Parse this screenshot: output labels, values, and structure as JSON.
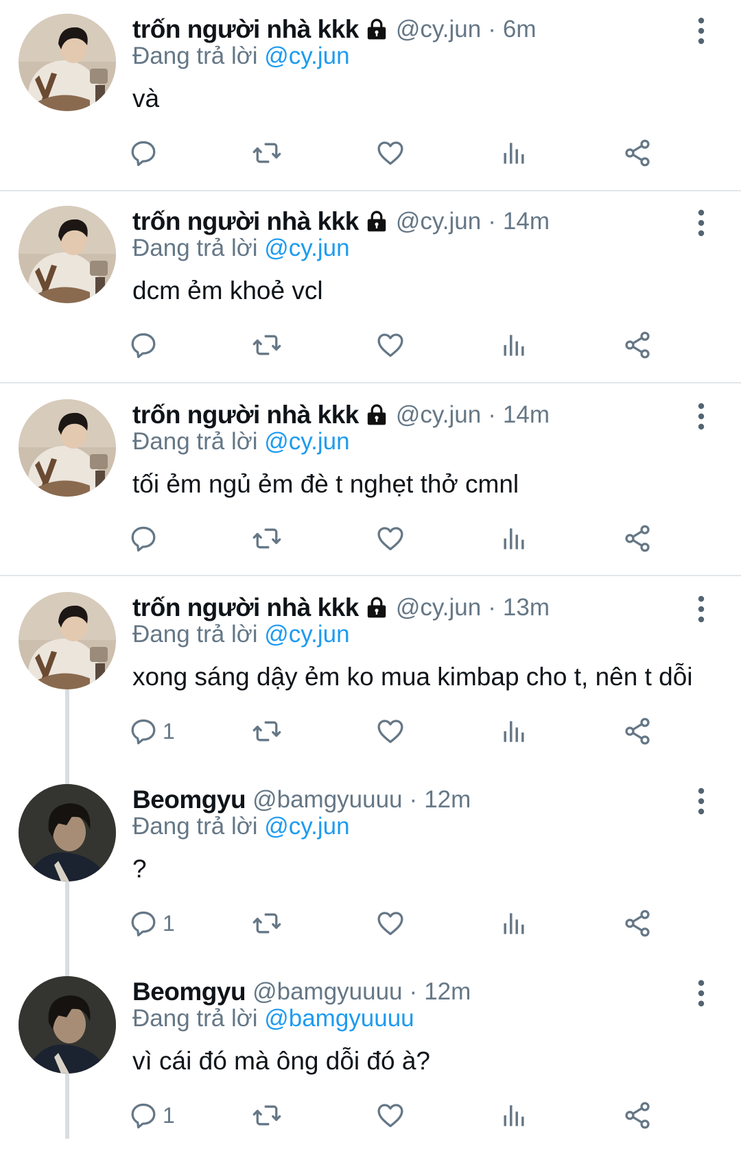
{
  "tweets": [
    {
      "display_name": "trốn người nhà kkk",
      "handle": "@cy.jun",
      "time": "6m",
      "reply_prefix": "Đang trả lời",
      "reply_to": "@cy.jun",
      "text": "và",
      "reply_count": "",
      "avatar": "avatar-man-apron"
    },
    {
      "display_name": "trốn người nhà kkk",
      "handle": "@cy.jun",
      "time": "14m",
      "reply_prefix": "Đang trả lời",
      "reply_to": "@cy.jun",
      "text": "dcm ẻm khoẻ vcl",
      "reply_count": "",
      "avatar": "avatar-man-apron"
    },
    {
      "display_name": "trốn người nhà kkk",
      "handle": "@cy.jun",
      "time": "14m",
      "reply_prefix": "Đang trả lời",
      "reply_to": "@cy.jun",
      "text": "tối ẻm ngủ ẻm đè t nghẹt thở cmnl",
      "reply_count": "",
      "avatar": "avatar-man-apron"
    },
    {
      "display_name": "trốn người nhà kkk",
      "handle": "@cy.jun",
      "time": "13m",
      "reply_prefix": "Đang trả lời",
      "reply_to": "@cy.jun",
      "text": "xong sáng dậy ẻm ko mua kimbap cho t, nên t dỗi",
      "reply_count": "1",
      "avatar": "avatar-man-apron"
    },
    {
      "display_name": "Beomgyu",
      "handle": "@bamgyuuuu",
      "time": "12m",
      "reply_prefix": "Đang trả lời",
      "reply_to": "@cy.jun",
      "text": "?",
      "reply_count": "1",
      "avatar": "avatar-dark-portrait"
    },
    {
      "display_name": "Beomgyu",
      "handle": "@bamgyuuuu",
      "time": "12m",
      "reply_prefix": "Đang trả lời",
      "reply_to": "@bamgyuuuu",
      "text": "vì cái đó mà ông dỗi đó à?",
      "reply_count": "1",
      "avatar": "avatar-dark-portrait"
    }
  ],
  "separator": "·",
  "icons": {
    "locked": "lock-icon",
    "more": "more-vertical-icon",
    "reply": "reply-icon",
    "retweet": "retweet-icon",
    "like": "heart-icon",
    "views": "analytics-icon",
    "share": "share-icon"
  },
  "colors": {
    "link": "#1d9bf0",
    "secondary_text": "#657786",
    "primary_text": "#0f1419",
    "divider": "#e1e6ea"
  }
}
